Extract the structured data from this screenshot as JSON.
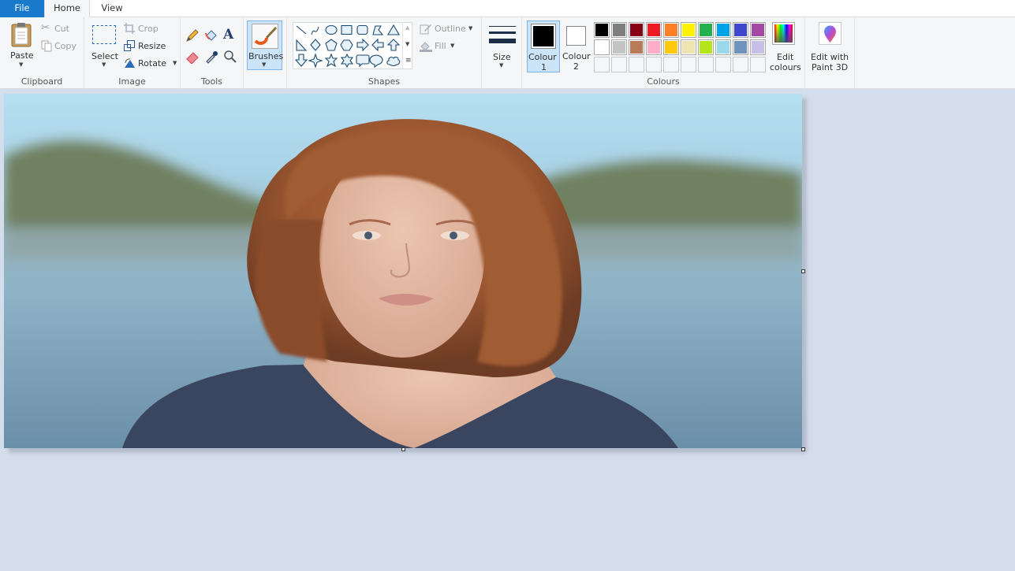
{
  "app": "Paint",
  "tabs": [
    {
      "label": "File",
      "active": false
    },
    {
      "label": "Home",
      "active": true
    },
    {
      "label": "View",
      "active": false
    }
  ],
  "ribbon": {
    "clipboard": {
      "group_label": "Clipboard",
      "paste": "Paste",
      "cut": "Cut",
      "copy": "Copy"
    },
    "image": {
      "group_label": "Image",
      "select": "Select",
      "crop": "Crop",
      "resize": "Resize",
      "rotate": "Rotate"
    },
    "tools": {
      "group_label": "Tools",
      "items": [
        "pencil",
        "fill",
        "text",
        "eraser",
        "colour-picker",
        "magnifier"
      ]
    },
    "brushes": {
      "label": "Brushes"
    },
    "shapes": {
      "group_label": "Shapes",
      "outline": "Outline",
      "fill": "Fill",
      "items": [
        "line",
        "curve",
        "oval",
        "rectangle",
        "rounded-rectangle",
        "polygon",
        "triangle",
        "right-triangle",
        "diamond",
        "pentagon",
        "hexagon",
        "right-arrow",
        "left-arrow",
        "up-arrow",
        "down-arrow",
        "four-point-star",
        "five-point-star",
        "six-point-star",
        "rounded-rectangular-callout",
        "oval-callout",
        "cloud-callout"
      ]
    },
    "size": {
      "label": "Size"
    },
    "colours": {
      "group_label": "Colours",
      "colour1_label": "Colour",
      "colour1_num": "1",
      "colour2_label": "Colour",
      "colour2_num": "2",
      "colour1": "#000000",
      "colour2": "#ffffff",
      "palette_row1": [
        "#000000",
        "#7f7f7f",
        "#880015",
        "#ed1c24",
        "#ff7f27",
        "#fff200",
        "#22b14c",
        "#00a2e8",
        "#3f48cc",
        "#a349a4"
      ],
      "palette_row2": [
        "#ffffff",
        "#c3c3c3",
        "#b97a57",
        "#ffaec9",
        "#ffc90e",
        "#efe4b0",
        "#b5e61d",
        "#99d9ea",
        "#7092be",
        "#c8bfe7"
      ],
      "edit_colours_line1": "Edit",
      "edit_colours_line2": "colours"
    },
    "paint3d": {
      "line1": "Edit with",
      "line2": "Paint 3D"
    }
  },
  "canvas": {
    "image_description": "Portrait photo of a young woman with shoulder-length auburn hair against a blurred lake and hills background"
  }
}
